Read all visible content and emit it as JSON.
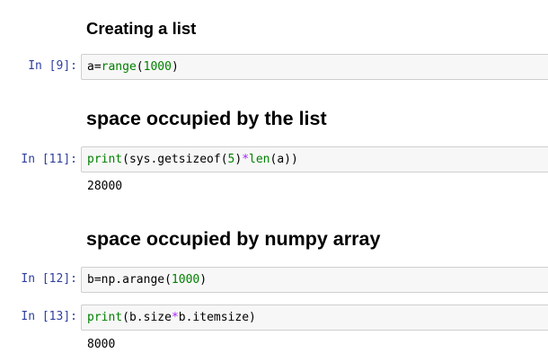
{
  "notebook": {
    "headings": {
      "creating_list": "Creating a list",
      "space_list": "space occupied by the list",
      "space_numpy": "space occupied by numpy array"
    },
    "cells": [
      {
        "prompt": "In [9]:",
        "code_parts": [
          "a=",
          "range",
          "(",
          "1000",
          ")"
        ]
      },
      {
        "prompt": "In [11]:",
        "code_parts": [
          "print",
          "(sys.getsizeof(",
          "5",
          ")",
          "*",
          "len",
          "(a))"
        ],
        "output": "28000"
      },
      {
        "prompt": "In [12]:",
        "code_parts": [
          "b=np.arange(",
          "1000",
          ")"
        ]
      },
      {
        "prompt": "In [13]:",
        "code_parts": [
          "print",
          "(b.size",
          "*",
          "b.itemsize)"
        ],
        "output": "8000"
      }
    ]
  }
}
